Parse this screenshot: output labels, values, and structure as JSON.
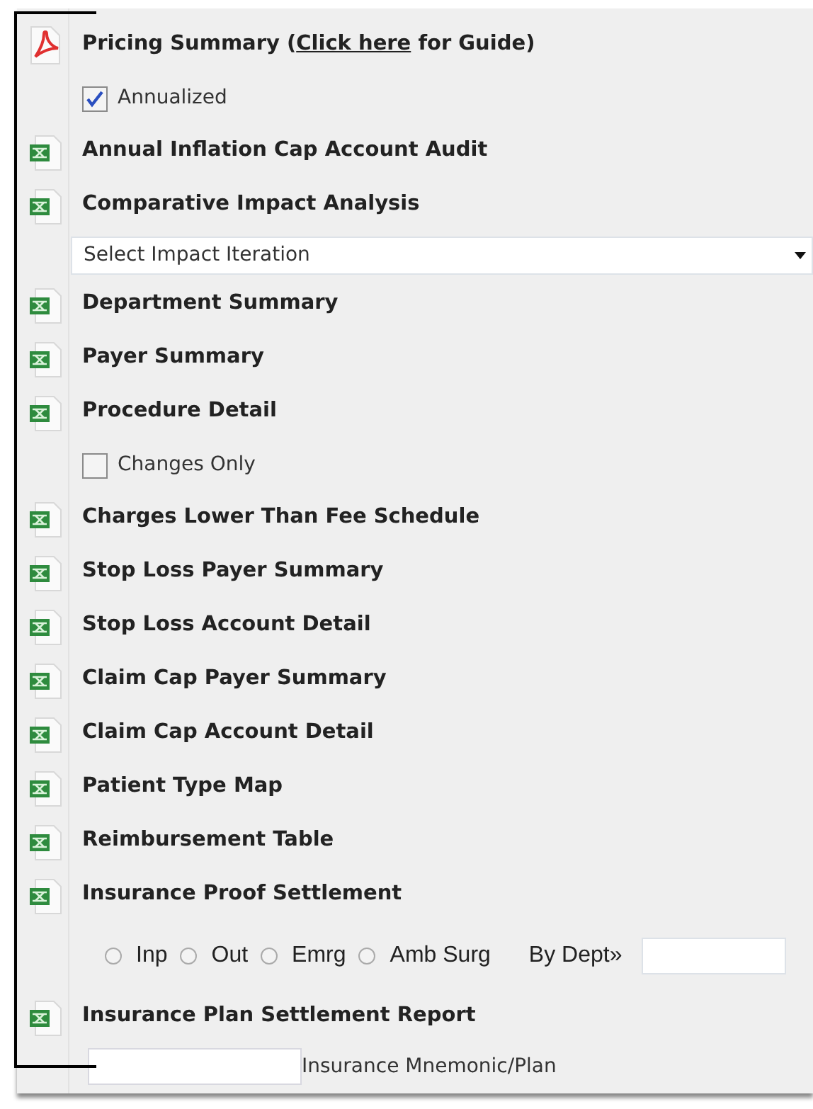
{
  "items": [
    {
      "kind": "pdf_report",
      "title": "Pricing Summary (",
      "link": "Click here",
      "title_end": " for Guide)"
    },
    {
      "kind": "checkbox",
      "label": "Annualized",
      "checked": true
    },
    {
      "kind": "sheet_report",
      "title": "Annual Inflation Cap Account Audit"
    },
    {
      "kind": "sheet_report",
      "title": "Comparative Impact Analysis"
    },
    {
      "kind": "select",
      "value": "Select Impact Iteration"
    },
    {
      "kind": "sheet_report",
      "title": "Department Summary"
    },
    {
      "kind": "sheet_report",
      "title": "Payer Summary"
    },
    {
      "kind": "sheet_report",
      "title": "Procedure Detail"
    },
    {
      "kind": "checkbox",
      "label": "Changes Only",
      "checked": false
    },
    {
      "kind": "sheet_report",
      "title": "Charges Lower Than Fee Schedule"
    },
    {
      "kind": "sheet_report",
      "title": "Stop Loss Payer Summary"
    },
    {
      "kind": "sheet_report",
      "title": "Stop Loss Account Detail"
    },
    {
      "kind": "sheet_report",
      "title": "Claim Cap Payer Summary"
    },
    {
      "kind": "sheet_report",
      "title": "Claim Cap Account Detail"
    },
    {
      "kind": "sheet_report",
      "title": "Patient Type Map"
    },
    {
      "kind": "sheet_report",
      "title": "Reimbursement Table"
    },
    {
      "kind": "sheet_report",
      "title": "Insurance Proof Settlement"
    },
    {
      "kind": "radios",
      "options": [
        {
          "label": "Inp",
          "selected": false
        },
        {
          "label": "Out",
          "selected": false
        },
        {
          "label": "Emrg",
          "selected": false
        },
        {
          "label": "Amb Surg",
          "selected": false
        }
      ],
      "dept_label": "By Dept»"
    },
    {
      "kind": "sheet_report",
      "title": "Insurance Plan Settlement Report"
    },
    {
      "kind": "labeled_field",
      "label": "Insurance Mnemonic/Plan"
    }
  ]
}
